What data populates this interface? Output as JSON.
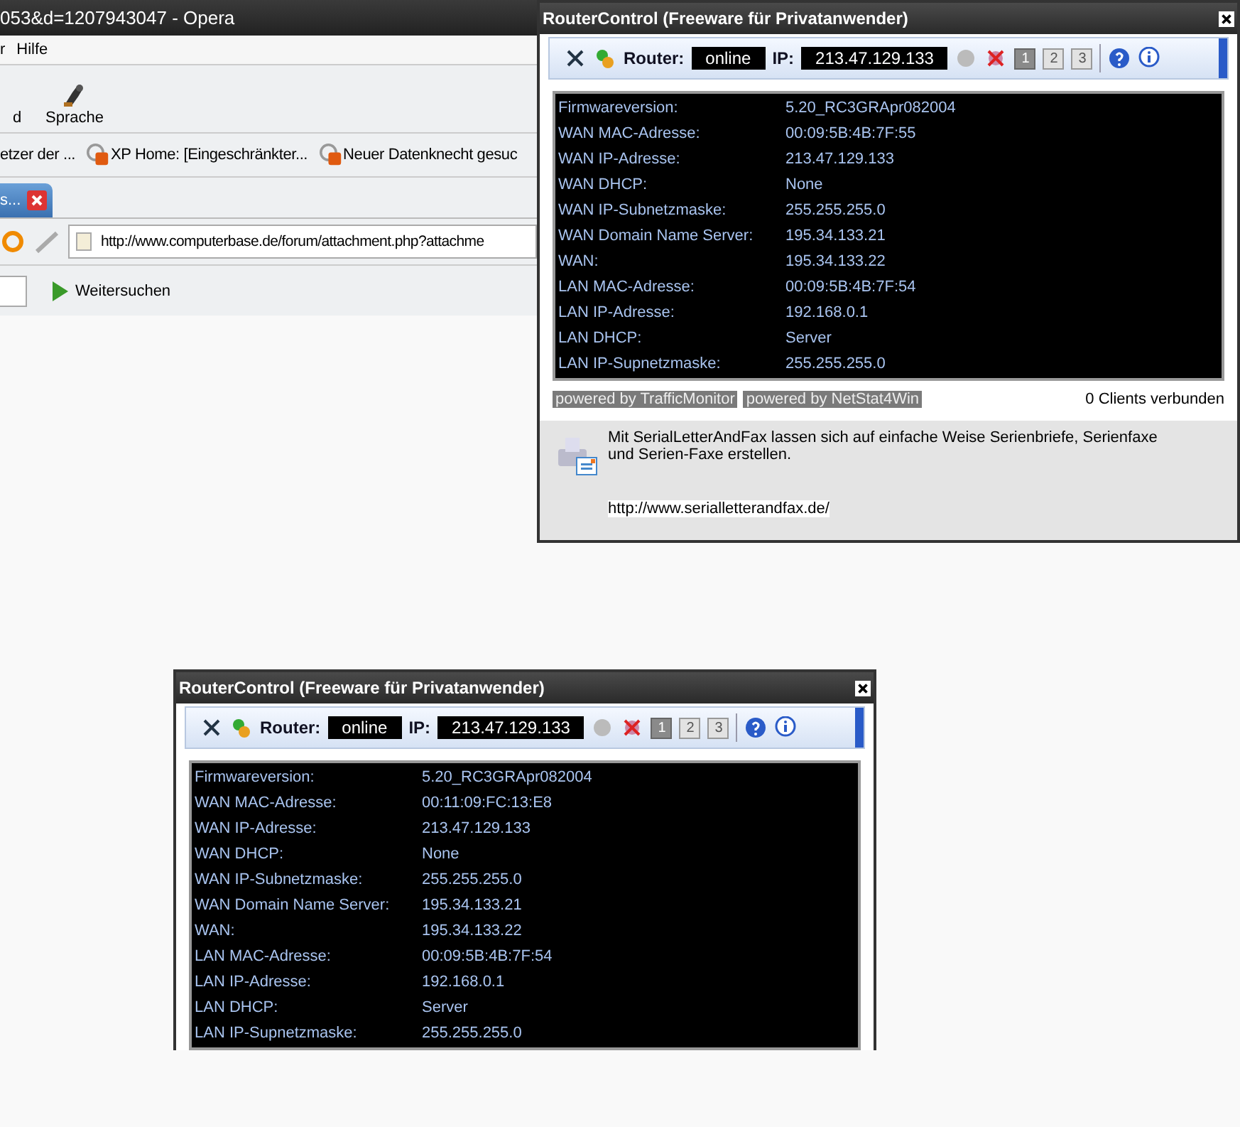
{
  "browser": {
    "title": "053&d=1207943047 - Opera",
    "menu": [
      "r",
      "Hilfe"
    ],
    "toolbar": [
      {
        "label": "d",
        "kind": "text"
      },
      {
        "label": "Sprache",
        "kind": "icon"
      }
    ],
    "bookmarks": [
      {
        "label": "etzer der ...",
        "kind": "text"
      },
      {
        "label": "XP Home: [Eingeschränkter...",
        "kind": "icon"
      },
      {
        "label": "Neuer Datenknecht gesuc",
        "kind": "icon"
      }
    ],
    "tab": {
      "label": "s...",
      "selected": true
    },
    "address": "http://www.computerbase.de/forum/attachment.php?attachme",
    "find_button": "Weitersuchen"
  },
  "windows": [
    {
      "title": "RouterControl (Freeware für Privatanwender)",
      "router_label": "Router:",
      "status": "online",
      "ip_label": "IP:",
      "ip": "213.47.129.133",
      "numbers": [
        {
          "label": "1",
          "disabled": false
        },
        {
          "label": "2",
          "disabled": true
        },
        {
          "label": "3",
          "disabled": true
        }
      ],
      "rows": [
        {
          "label": "Firmwareversion:",
          "value": "5.20_RC3GRApr082004"
        },
        {
          "label": "WAN MAC-Adresse:",
          "value": "00:09:5B:4B:7F:55"
        },
        {
          "label": "WAN IP-Adresse:",
          "value": "213.47.129.133"
        },
        {
          "label": "WAN DHCP:",
          "value": "None"
        },
        {
          "label": "WAN IP-Subnetzmaske:",
          "value": "255.255.255.0"
        },
        {
          "label": "WAN Domain Name Server:",
          "value": "195.34.133.21"
        },
        {
          "label": "WAN:",
          "value": "195.34.133.22"
        },
        {
          "label": "LAN MAC-Adresse:",
          "value": "00:09:5B:4B:7F:54"
        },
        {
          "label": "LAN IP-Adresse:",
          "value": "192.168.0.1"
        },
        {
          "label": "LAN DHCP:",
          "value": "Server"
        },
        {
          "label": "LAN IP-Supnetzmaske:",
          "value": "255.255.255.0"
        }
      ],
      "footer": {
        "powered": [
          "powered by TrafficMonitor",
          "powered by NetStat4Win"
        ],
        "clients": "0 Clients verbunden",
        "ad_text": "Mit SerialLetterAndFax lassen sich auf einfache Weise Serienbriefe, Serienfaxe und Serien-Faxe erstellen.",
        "ad_link": "http://www.serialletterandfax.de/"
      }
    },
    {
      "title": "RouterControl (Freeware für Privatanwender)",
      "router_label": "Router:",
      "status": "online",
      "ip_label": "IP:",
      "ip": "213.47.129.133",
      "numbers": [
        {
          "label": "1",
          "disabled": false
        },
        {
          "label": "2",
          "disabled": true
        },
        {
          "label": "3",
          "disabled": true
        }
      ],
      "rows": [
        {
          "label": "Firmwareversion:",
          "value": "5.20_RC3GRApr082004"
        },
        {
          "label": "WAN MAC-Adresse:",
          "value": "00:11:09:FC:13:E8"
        },
        {
          "label": "WAN IP-Adresse:",
          "value": "213.47.129.133"
        },
        {
          "label": "WAN DHCP:",
          "value": "None"
        },
        {
          "label": "WAN IP-Subnetzmaske:",
          "value": "255.255.255.0"
        },
        {
          "label": "WAN Domain Name Server:",
          "value": "195.34.133.21"
        },
        {
          "label": "WAN:",
          "value": "195.34.133.22"
        },
        {
          "label": "LAN MAC-Adresse:",
          "value": "00:09:5B:4B:7F:54"
        },
        {
          "label": "LAN IP-Adresse:",
          "value": "192.168.0.1"
        },
        {
          "label": "LAN DHCP:",
          "value": "Server"
        },
        {
          "label": "LAN IP-Supnetzmaske:",
          "value": "255.255.255.0"
        }
      ]
    }
  ]
}
